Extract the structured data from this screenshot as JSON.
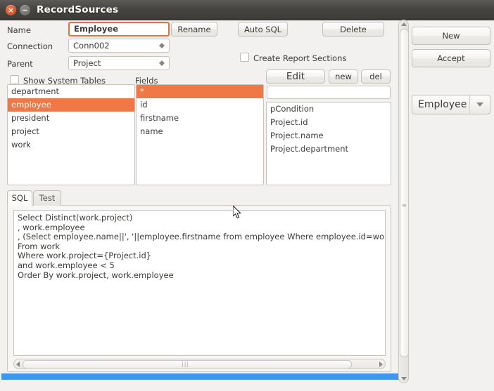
{
  "window": {
    "title": "RecordSources",
    "close_glyph": "×",
    "minimize_glyph": "−"
  },
  "form": {
    "name_label": "Name",
    "name_value": "Employee",
    "rename_button": "Rename",
    "connection_label": "Connection",
    "connection_value": "Conn002",
    "parent_label": "Parent",
    "parent_value": "Project",
    "auto_sql_button": "Auto SQL",
    "delete_button": "Delete",
    "create_report_sections_label": "Create Report Sections",
    "create_report_sections_checked": false,
    "show_system_tables_label": "Show System Tables",
    "show_system_tables_checked": false,
    "fields_label": "Fields"
  },
  "tables_list": {
    "items": [
      "department",
      "employee",
      "president",
      "project",
      "work"
    ],
    "selected": "employee"
  },
  "fields_list": {
    "items": [
      "*",
      "id",
      "firstname",
      "name"
    ],
    "selected": "*"
  },
  "params": {
    "edit_button": "Edit",
    "new_button": "new",
    "del_button": "del",
    "input_value": "",
    "items": [
      "pCondition",
      "Project.id",
      "Project.name",
      "Project.department"
    ]
  },
  "tabs": {
    "items": [
      {
        "label": "SQL",
        "active": true
      },
      {
        "label": "Test",
        "active": false
      }
    ]
  },
  "sql": {
    "text": "Select Distinct(work.project)\n, work.employee\n, (Select employee.name||', '||employee.firstname from employee Where employee.id=work.employee) as N\nFrom work\nWhere work.project={Project.id}\nand work.employee < 5\nOrder By work.project, work.employee"
  },
  "sidebar": {
    "new_button": "New",
    "accept_button": "Accept",
    "record_source_selected": "Employee"
  },
  "colors": {
    "accent_orange": "#f07746",
    "titlebar_dark": "#3c3b37",
    "status_blue": "#3d97f0",
    "window_bg": "#f2f1f0"
  }
}
